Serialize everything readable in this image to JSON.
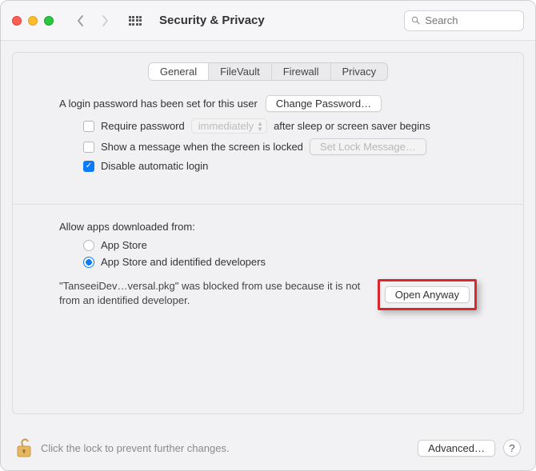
{
  "window": {
    "title": "Security & Privacy"
  },
  "search": {
    "placeholder": "Search"
  },
  "tabs": {
    "general": "General",
    "filevault": "FileVault",
    "firewall": "Firewall",
    "privacy": "Privacy"
  },
  "general": {
    "password_set_text": "A login password has been set for this user",
    "change_password_btn": "Change Password…",
    "require_pw_label": "Require password",
    "require_pw_select": "immediately",
    "require_pw_after": "after sleep or screen saver begins",
    "show_message_label": "Show a message when the screen is locked",
    "set_lock_message_btn": "Set Lock Message…",
    "disable_auto_login_label": "Disable automatic login"
  },
  "allow_apps": {
    "heading": "Allow apps downloaded from:",
    "option_appstore": "App Store",
    "option_identified": "App Store and identified developers",
    "blocked_msg": "\"TanseeiDev…versal.pkg\" was blocked from use because it is not from an identified developer.",
    "open_anyway_btn": "Open Anyway"
  },
  "footer": {
    "lock_text": "Click the lock to prevent further changes.",
    "advanced_btn": "Advanced…",
    "help": "?"
  }
}
